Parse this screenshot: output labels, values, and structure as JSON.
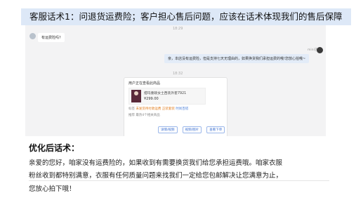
{
  "header": {
    "title": "客服话术1：问退货运费险；客户担心售后问题，应该在话术体现我们的售后保障"
  },
  "chat": {
    "time1": "18:29",
    "customer_msg": "有运费险吗?",
    "agent_nick": "mini店",
    "agent_msg": "亲，本店没有运费险，但是支持七天无理由的，如果换货我们承担运费的哦!您放心拍哦~",
    "time2": "18:32",
    "card": {
      "title": "用户正在查看此商品",
      "product_name": "搭玛重磅女士西装外套7921",
      "price": "¥299.00",
      "tags_label": "标签",
      "tags": [
        "未发货待付款运费",
        "正装套装",
        "时尚百搭"
      ],
      "recommend": "推荐 最热4个相关商品",
      "actions": [
        "详情/视频",
        "视频/图片",
        "查看下单"
      ]
    }
  },
  "optimized": {
    "heading": "优化后话术：",
    "lines": [
      "亲爱的您好，咱家没有运费险的，如果收到有需要换货我们给您承担运费哦。咱家衣服",
      "粉丝收到都特别满意，衣服有任何质量问题来找我们一定给您包邮解决让您满意为止，",
      "您放心拍下哦！"
    ]
  },
  "colors": {
    "title_bg": "#dde8f7",
    "agent_bubble": "#e3ecf8",
    "accent_orange": "#e07a19",
    "link_blue": "#3c6fd0"
  }
}
